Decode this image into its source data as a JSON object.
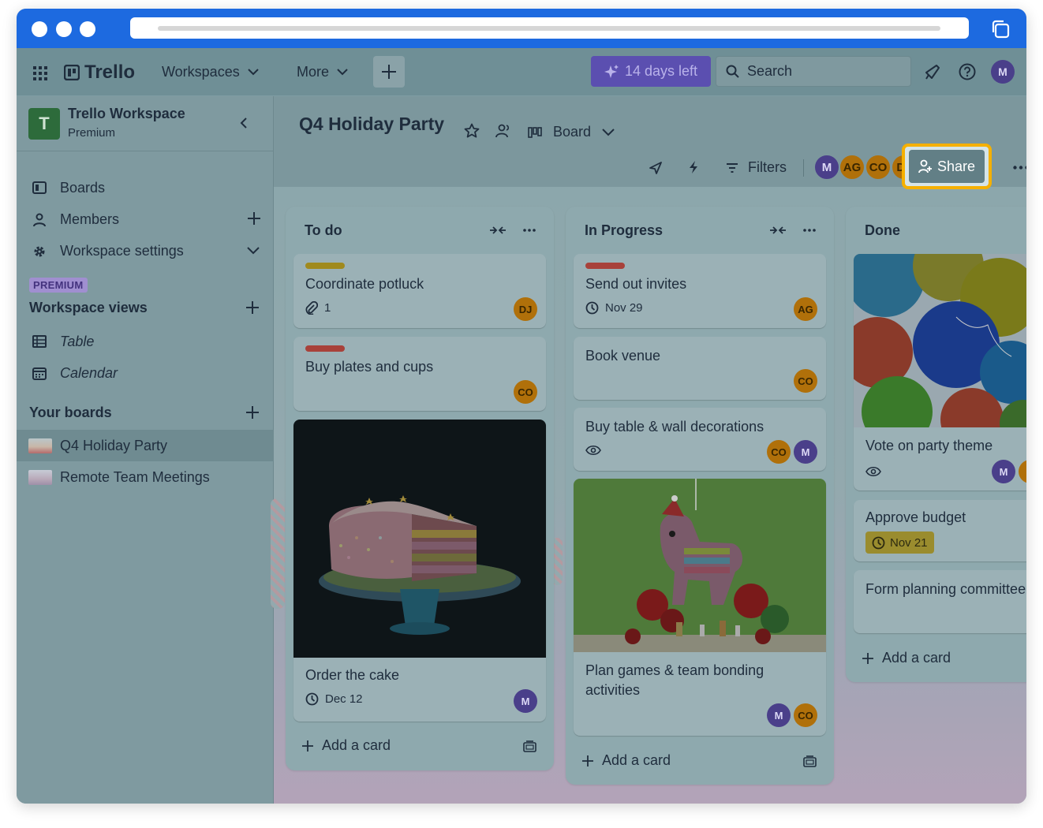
{
  "topnav": {
    "brand": "Trello",
    "workspaces_label": "Workspaces",
    "more_label": "More",
    "trial_label": "14 days left",
    "search_placeholder": "Search",
    "user_initial": "M"
  },
  "sidebar": {
    "workspace_initial": "T",
    "workspace_name": "Trello Workspace",
    "workspace_tier": "Premium",
    "items": [
      {
        "label": "Boards"
      },
      {
        "label": "Members"
      },
      {
        "label": "Workspace settings"
      }
    ],
    "premium_badge": "PREMIUM",
    "views_title": "Workspace views",
    "views": [
      {
        "label": "Table"
      },
      {
        "label": "Calendar"
      }
    ],
    "boards_title": "Your boards",
    "boards": [
      {
        "label": "Q4 Holiday Party",
        "active": true
      },
      {
        "label": "Remote Team Meetings",
        "active": false
      }
    ]
  },
  "board": {
    "title": "Q4 Holiday Party",
    "view_label": "Board",
    "filters_label": "Filters",
    "share_label": "Share",
    "members": [
      "M",
      "AG",
      "CO",
      "DJ"
    ]
  },
  "lists": [
    {
      "title": "To do",
      "add_label": "Add a card",
      "cards": [
        {
          "title": "Coordinate potluck",
          "label_color": "#a08a1e",
          "attachments": "1",
          "members": [
            "DJ"
          ]
        },
        {
          "title": "Buy plates and cups",
          "label_color": "#a8413a",
          "members": [
            "CO"
          ]
        },
        {
          "title": "Order the cake",
          "due": "Dec 12",
          "members": [
            "M"
          ],
          "cover": "cake"
        }
      ]
    },
    {
      "title": "In Progress",
      "add_label": "Add a card",
      "cards": [
        {
          "title": "Send out invites",
          "label_color": "#a8413a",
          "due": "Nov 29",
          "members": [
            "AG"
          ]
        },
        {
          "title": "Book venue",
          "members": [
            "CO"
          ]
        },
        {
          "title": "Buy table & wall decorations",
          "watching": true,
          "members": [
            "CO",
            "M"
          ]
        },
        {
          "title_line1": "Plan games & team bonding",
          "title_line2": "activities",
          "members": [
            "M",
            "CO"
          ],
          "cover": "pinata"
        }
      ]
    },
    {
      "title": "Done",
      "add_label": "Add a card",
      "cards": [
        {
          "title": "Vote on party theme",
          "watching": true,
          "members": [
            "M"
          ],
          "cover": "balloons"
        },
        {
          "title": "Approve budget",
          "due": "Nov 21"
        },
        {
          "title": "Form planning committee"
        }
      ]
    }
  ]
}
